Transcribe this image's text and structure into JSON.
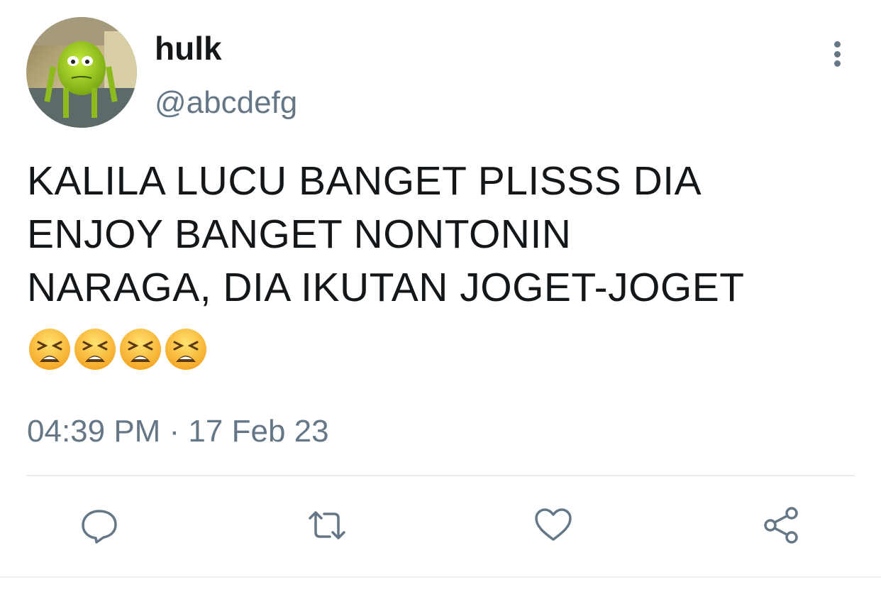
{
  "tweet": {
    "author": {
      "display_name": "hulk",
      "handle": "@abcdefg",
      "avatar_icon": "green-monster-avatar"
    },
    "text": "KALILA LUCU BANGET PLISSS DIA\nENJOY BANGET NONTONIN\nNARAGA, DIA IKUTAN JOGET-JOGET",
    "emojis": [
      "😫",
      "😫",
      "😫",
      "😫"
    ],
    "timestamp": "04:39 PM · 17 Feb 23"
  },
  "actions": [
    {
      "icon": "reply-icon"
    },
    {
      "icon": "retweet-icon"
    },
    {
      "icon": "like-icon"
    },
    {
      "icon": "share-icon"
    }
  ],
  "menu": {
    "icon": "more-vertical-icon"
  },
  "colors": {
    "text": "#14171a",
    "secondary": "#657786",
    "divider": "#e6ecf0"
  }
}
